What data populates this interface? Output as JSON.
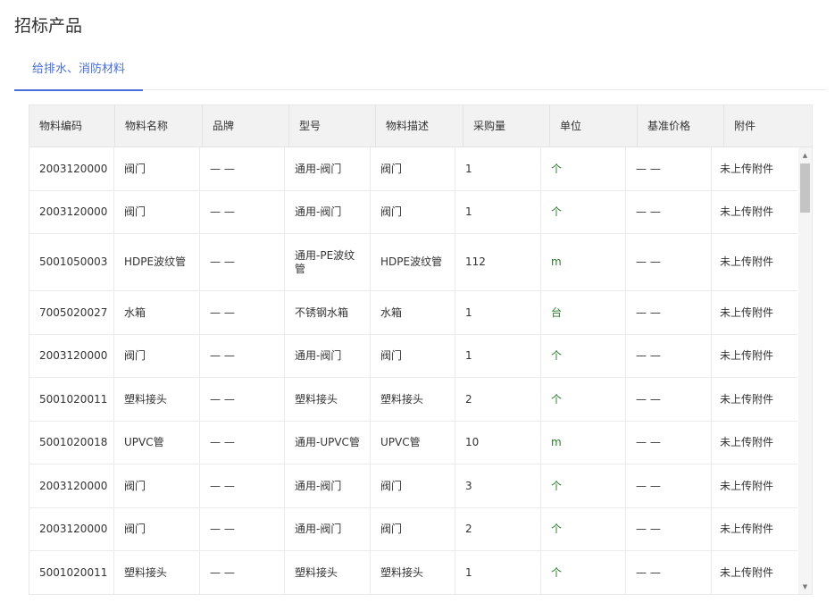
{
  "page": {
    "title": "招标产品"
  },
  "tabs": [
    {
      "label": "给排水、消防材料",
      "active": true
    }
  ],
  "table": {
    "columns": [
      "物料编码",
      "物料名称",
      "品牌",
      "型号",
      "物料描述",
      "采购量",
      "单位",
      "基准价格",
      "附件"
    ],
    "rows": [
      [
        "2003120000",
        "阀门",
        "— —",
        "通用-阀门",
        "阀门",
        "1",
        "个",
        "— —",
        "未上传附件"
      ],
      [
        "2003120000",
        "阀门",
        "— —",
        "通用-阀门",
        "阀门",
        "1",
        "个",
        "— —",
        "未上传附件"
      ],
      [
        "5001050003",
        "HDPE波纹管",
        "— —",
        "通用-PE波纹管",
        "HDPE波纹管",
        "112",
        "m",
        "— —",
        "未上传附件"
      ],
      [
        "7005020027",
        "水箱",
        "— —",
        "不锈钢水箱",
        "水箱",
        "1",
        "台",
        "— —",
        "未上传附件"
      ],
      [
        "2003120000",
        "阀门",
        "— —",
        "通用-阀门",
        "阀门",
        "1",
        "个",
        "— —",
        "未上传附件"
      ],
      [
        "5001020011",
        "塑料接头",
        "— —",
        "塑料接头",
        "塑料接头",
        "2",
        "个",
        "— —",
        "未上传附件"
      ],
      [
        "5001020018",
        "UPVC管",
        "— —",
        "通用-UPVC管",
        "UPVC管",
        "10",
        "m",
        "— —",
        "未上传附件"
      ],
      [
        "2003120000",
        "阀门",
        "— —",
        "通用-阀门",
        "阀门",
        "3",
        "个",
        "— —",
        "未上传附件"
      ],
      [
        "2003120000",
        "阀门",
        "— —",
        "通用-阀门",
        "阀门",
        "2",
        "个",
        "— —",
        "未上传附件"
      ],
      [
        "5001020011",
        "塑料接头",
        "— —",
        "塑料接头",
        "塑料接头",
        "1",
        "个",
        "— —",
        "未上传附件"
      ]
    ]
  },
  "scrollbar": {
    "up_icon": "caret-up-icon",
    "down_icon": "caret-down-icon"
  },
  "colors": {
    "accent": "#4a6fd8",
    "header_bg": "#f2f2f2",
    "border": "#e8e8e8",
    "unit_text": "#2a7a2a"
  }
}
